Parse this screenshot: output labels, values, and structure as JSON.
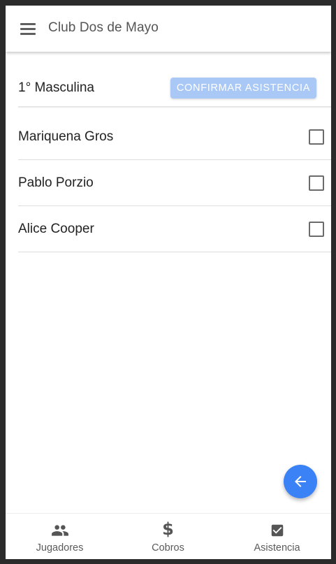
{
  "app": {
    "title": "Club Dos de Mayo",
    "menu_icon": "hamburger-menu-icon"
  },
  "section": {
    "category": "1° Masculina",
    "confirm_label": "CONFIRMAR ASISTENCIA",
    "confirm_enabled": false
  },
  "players": [
    {
      "name": "Mariquena Gros",
      "checked": false
    },
    {
      "name": "Pablo Porzio",
      "checked": false
    },
    {
      "name": "Alice Cooper",
      "checked": false
    }
  ],
  "fab": {
    "icon": "arrow-back-icon"
  },
  "bottom_nav": {
    "items": [
      {
        "label": "Jugadores",
        "icon": "people-icon"
      },
      {
        "label": "Cobros",
        "icon": "dollar-icon"
      },
      {
        "label": "Asistencia",
        "icon": "checkbox-checked-icon"
      }
    ]
  },
  "colors": {
    "accent": "#3b82f6",
    "button_disabled": "#a9c8f6",
    "frame": "#2b2b2b"
  }
}
